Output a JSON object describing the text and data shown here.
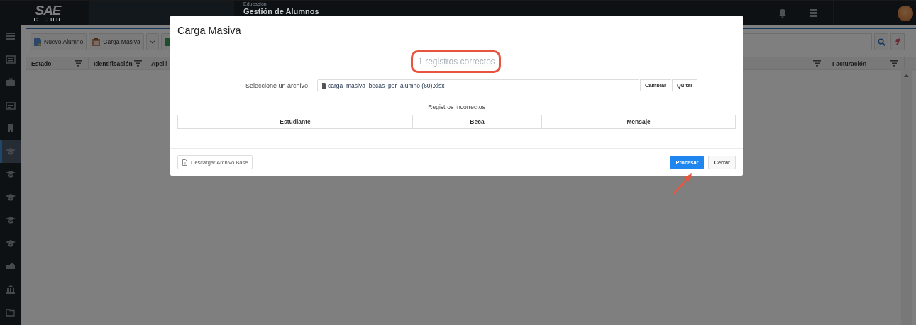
{
  "top_bar": {
    "logo": {
      "mark": "SAE",
      "subtitle": "CLOUD"
    },
    "module": "Educación",
    "page_title": "Gestión de Alumnos"
  },
  "sidebar": {
    "items": [
      {
        "selected": false
      },
      {
        "selected": false
      },
      {
        "selected": false
      },
      {
        "selected": false
      },
      {
        "selected": false
      },
      {
        "selected": true
      },
      {
        "selected": false
      },
      {
        "selected": false
      },
      {
        "selected": false
      },
      {
        "selected": false
      },
      {
        "selected": false
      },
      {
        "selected": false
      },
      {
        "selected": false
      }
    ]
  },
  "toolbar": {
    "buttons": [
      {
        "kind": "new",
        "label": "Nuevo Alumno"
      },
      {
        "kind": "upload",
        "label": "Carga Masiva"
      },
      {
        "kind": "caret"
      },
      {
        "kind": "export"
      }
    ]
  },
  "table": {
    "columns": [
      "Estado",
      "Identificación",
      "Apelli",
      "Facturación"
    ]
  },
  "modal": {
    "title": "Carga Masiva",
    "status": "1 registros correctos",
    "file_label": "Seleccione un archivo",
    "file_name": "carga_masiva_becas_por_alumno (60).xlsx",
    "file_buttons": [
      "Cambiar",
      "Quitar"
    ],
    "section_title": "Registros Incorrectos",
    "columns": [
      "Estudiante",
      "Beca",
      "Mensaje"
    ],
    "download_button": "Descargar Archivo Base",
    "actions": [
      {
        "label": "Procesar",
        "primary": true
      },
      {
        "label": "Cerrar",
        "primary": false
      }
    ]
  },
  "annotations": {
    "status_outline": true,
    "process_arrow": true
  }
}
